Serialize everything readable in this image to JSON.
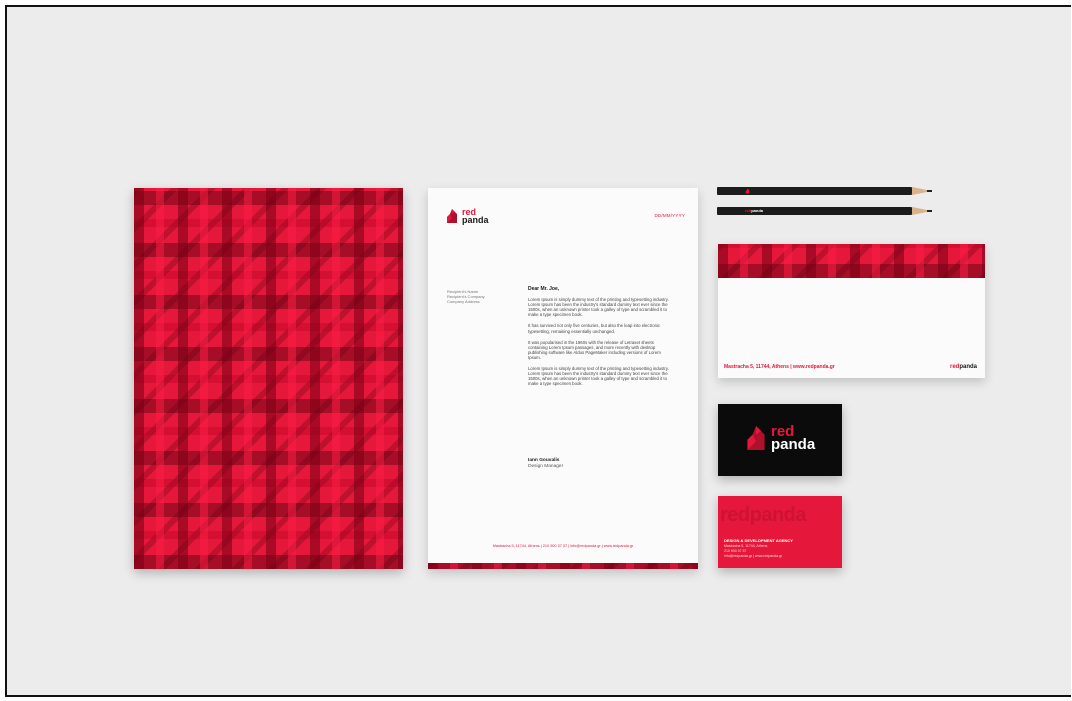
{
  "brand": {
    "word1": "red",
    "word2": "panda",
    "color": "#e5173a"
  },
  "letterhead": {
    "date": "DD/MM/YYYY",
    "recipient": [
      "Recipient's Name",
      "Recipient's Company",
      "Company Address"
    ],
    "greeting": "Dear Mr. Joe,",
    "paragraphs": [
      "Lorem Ipsum is simply dummy text of the printing and typesetting industry. Lorem Ipsum has been the industry's standard dummy text ever since the 1500s, when an unknown printer took a galley of type and scrambled it to make a type specimen book.",
      "It has survived not only five centuries, but also the leap into electronic typesetting, remaining essentially unchanged.",
      "It was popularised in the 1960s with the release of Letraset sheets containing Lorem Ipsum passages, and more recently with desktop publishing software like Aldus PageMaker including versions of Lorem Ipsum.",
      "Lorem Ipsum is simply dummy text of the printing and typesetting industry. Lorem Ipsum has been the industry's standard dummy text ever since the 1500s, when an unknown printer took a galley of type and scrambled it to make a type specimen book."
    ],
    "signature_name": "Iann Gouvalis",
    "signature_role": "Design Manager",
    "footer": "Mastracha 5, 11744, Athens | 210 900 37 37 | info@redpanda.gr | www.redpanda.gr"
  },
  "pencil": {
    "label": "redpanda"
  },
  "envelope": {
    "address": "Mastracha 5, 11744, Athens | www.redpanda.gr",
    "brand_red": "red",
    "brand_dark": "panda"
  },
  "card_red": {
    "ghost": "redpanda",
    "title": "DESIGN & DEVELOPMENT AGENCY",
    "lines": [
      "Mastracha 5, 11744, Athens",
      "210 900 37 37",
      "info@redpanda.gr | www.redpanda.gr"
    ]
  }
}
